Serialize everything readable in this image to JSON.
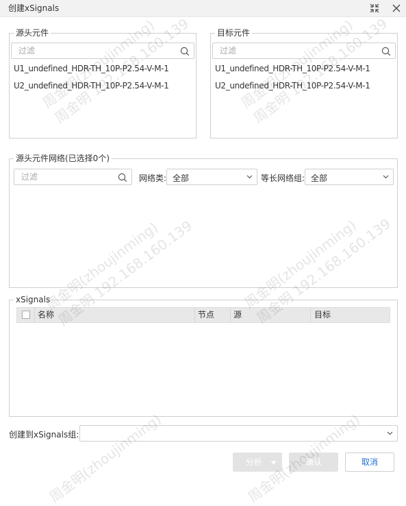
{
  "window": {
    "title": "创建xSignals",
    "maximize_icon": "collapse-arrows-icon",
    "close_icon": "close-icon"
  },
  "source_components": {
    "legend": "源头元件",
    "filter_placeholder": "过滤",
    "items": [
      "U1_undefined_HDR-TH_10P-P2.54-V-M-1",
      "U2_undefined_HDR-TH_10P-P2.54-V-M-1"
    ]
  },
  "target_components": {
    "legend": "目标元件",
    "filter_placeholder": "过滤",
    "items": [
      "U1_undefined_HDR-TH_10P-P2.54-V-M-1",
      "U2_undefined_HDR-TH_10P-P2.54-V-M-1"
    ]
  },
  "source_nets": {
    "legend": "源头元件网络(已选择0个)",
    "filter_placeholder": "过滤",
    "net_class_label": "网络类:",
    "net_class_value": "全部",
    "equal_length_label": "等长网络组:",
    "equal_length_value": "全部"
  },
  "xsignals": {
    "legend": "xSignals",
    "columns": [
      "名称",
      "节点",
      "源",
      "目标"
    ],
    "rows": []
  },
  "create_group": {
    "label": "创建到xSignals组:",
    "value": ""
  },
  "buttons": {
    "analyze": "分析",
    "confirm": "确认",
    "cancel": "取消"
  },
  "colors": {
    "accent": "#1f6fd0",
    "disabled_button": "#e3e3e3",
    "titlebar": "#f2f2f2"
  },
  "watermark": {
    "lines": [
      "周金明(zhoujinming)",
      "周金明 192.168.160.139"
    ]
  }
}
